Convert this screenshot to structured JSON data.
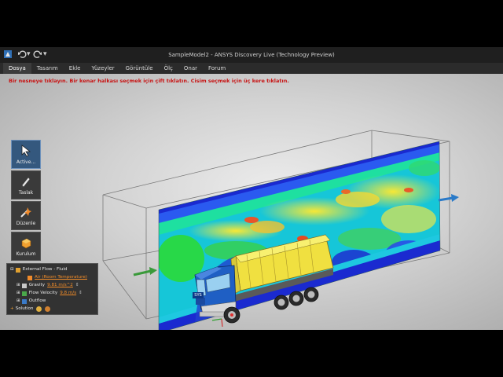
{
  "window": {
    "title": "SampleModel2 - ANSYS Discovery Live (Technology Preview)"
  },
  "menu": {
    "items": [
      {
        "label": "Dosya"
      },
      {
        "label": "Tasarım"
      },
      {
        "label": "Ekle"
      },
      {
        "label": "Yüzeyler"
      },
      {
        "label": "Görüntüle"
      },
      {
        "label": "Ölç"
      },
      {
        "label": "Onar"
      },
      {
        "label": "Forum"
      }
    ]
  },
  "viewport": {
    "hint": "Bir nesneye tıklayın. Bir kenar halkası seçmek için çift tıklatın. Cisim seçmek için üç kere tıklatın.",
    "truck_badge": "SYS"
  },
  "tools": [
    {
      "label": "Active...",
      "icon": "cursor-arrow-icon"
    },
    {
      "label": "Taslak",
      "icon": "pencil-icon"
    },
    {
      "label": "Düzenle",
      "icon": "edit-wand-icon"
    },
    {
      "label": "Kurulum",
      "icon": "setup-box-icon"
    }
  ],
  "tree": {
    "root": "External Flow - Fluid",
    "material": "Air (Room Temperature)",
    "gravity_label": "Gravity",
    "gravity_value": "9.81 m/s^2",
    "velocity_label": "Flow Velocity",
    "velocity_value": "9.8 m/s",
    "outflow_label": "Outflow",
    "solution_label": "Solution"
  },
  "colors": {
    "menu_active": "#3c3c3c",
    "tool_active": "#34587e",
    "hint_text": "#c81414",
    "link_text": "#f28c28",
    "truck_cab": "#1f5fc4",
    "truck_bed": "#f0e040",
    "flow_arrow": "#3a9a3a",
    "outflow_arrow": "#2a7ac8"
  }
}
